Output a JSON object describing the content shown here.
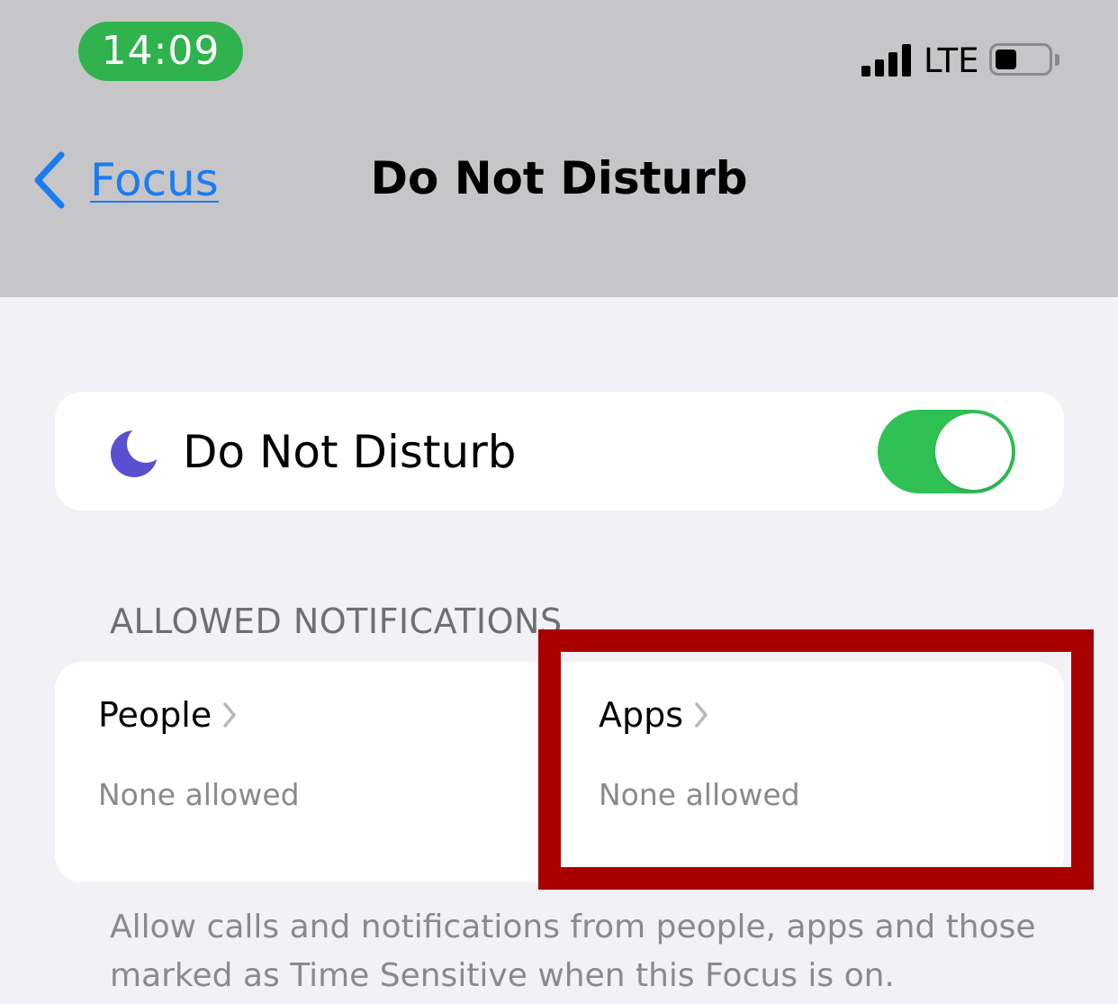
{
  "status_bar": {
    "time": "14:09",
    "network": "LTE",
    "icons": [
      "signal-icon",
      "battery-icon"
    ]
  },
  "nav": {
    "back_label": "Focus",
    "title": "Do Not Disturb",
    "icons": [
      "chevron-left-icon"
    ]
  },
  "focus_toggle": {
    "label": "Do Not Disturb",
    "icon": "moon-icon",
    "enabled": true,
    "accent_color": "#30c155"
  },
  "allowed_notifications": {
    "header": "ALLOWED NOTIFICATIONS",
    "items": [
      {
        "label": "People",
        "value": "None allowed"
      },
      {
        "label": "Apps",
        "value": "None allowed"
      }
    ],
    "footer": "Allow calls and notifications from people, apps and those marked as Time Sensitive when this Focus is on."
  },
  "colors": {
    "link": "#1a7cf2",
    "time_pill": "#30b24f",
    "highlight": "#a80000",
    "header_background": "#c6c6c9",
    "page_background": "#f1f1f6"
  }
}
